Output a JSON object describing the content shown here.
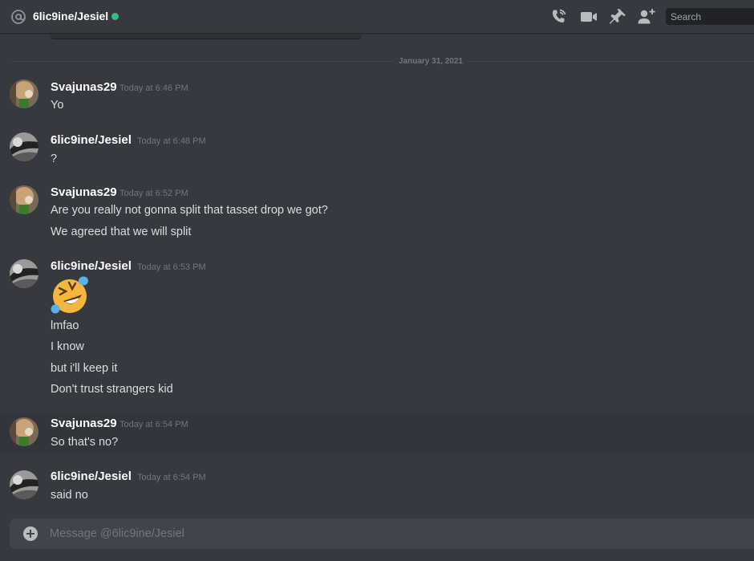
{
  "header": {
    "title": "6lic9ine/Jesiel",
    "status": "online",
    "status_color": "#43b581",
    "icons": [
      "voice-call-icon",
      "video-call-icon",
      "pin-icon",
      "add-friend-icon"
    ],
    "search_placeholder": "Search"
  },
  "divider": {
    "date": "January 31, 2021"
  },
  "messages": [
    {
      "author": "Svajunas29",
      "time": "Today at 6:46 PM",
      "lines": [
        "Yo"
      ]
    },
    {
      "author": "6lic9ine/Jesiel",
      "time": "Today at 6:48 PM",
      "lines": [
        "?"
      ]
    },
    {
      "author": "Svajunas29",
      "time": "Today at 6:52 PM",
      "lines": [
        "Are you really not gonna split that tasset drop we got?",
        "We agreed that we will split"
      ]
    },
    {
      "author": "6lic9ine/Jesiel",
      "time": "Today at 6:53 PM",
      "emoji": "rolling-on-floor-laughing-emoji",
      "lines": [
        "lmfao",
        "I know",
        "but i'll keep it",
        "Don't trust strangers kid"
      ]
    },
    {
      "author": "Svajunas29",
      "time": "Today at 6:54 PM",
      "lines": [
        "So that's no?"
      ]
    },
    {
      "author": "6lic9ine/Jesiel",
      "time": "Today at 6:54 PM",
      "lines": [
        "said no"
      ]
    }
  ],
  "composer": {
    "placeholder": "Message @6lic9ine/Jesiel"
  },
  "colors": {
    "background": "#36393f",
    "composer": "#40444b",
    "username": "#ffffff",
    "timestamp": "#72767d",
    "text": "#dcddde"
  }
}
